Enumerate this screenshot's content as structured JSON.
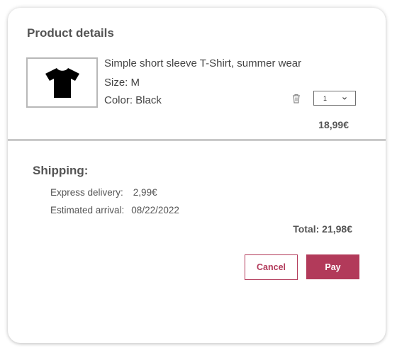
{
  "title": "Product details",
  "product": {
    "name": "Simple short sleeve T-Shirt, summer wear",
    "size": "Size: M",
    "color": "Color: Black",
    "image_icon": "tshirt-icon",
    "quantity": "1",
    "price": "18,99€"
  },
  "shipping": {
    "title": "Shipping:",
    "delivery_label": "Express delivery:",
    "delivery_value": "2,99€",
    "arrival_label": "Estimated arrival:",
    "arrival_value": "08/22/2022"
  },
  "total": "Total: 21,98€",
  "buttons": {
    "cancel": "Cancel",
    "pay": "Pay"
  },
  "colors": {
    "accent": "#b23a5a",
    "text": "#444444"
  }
}
